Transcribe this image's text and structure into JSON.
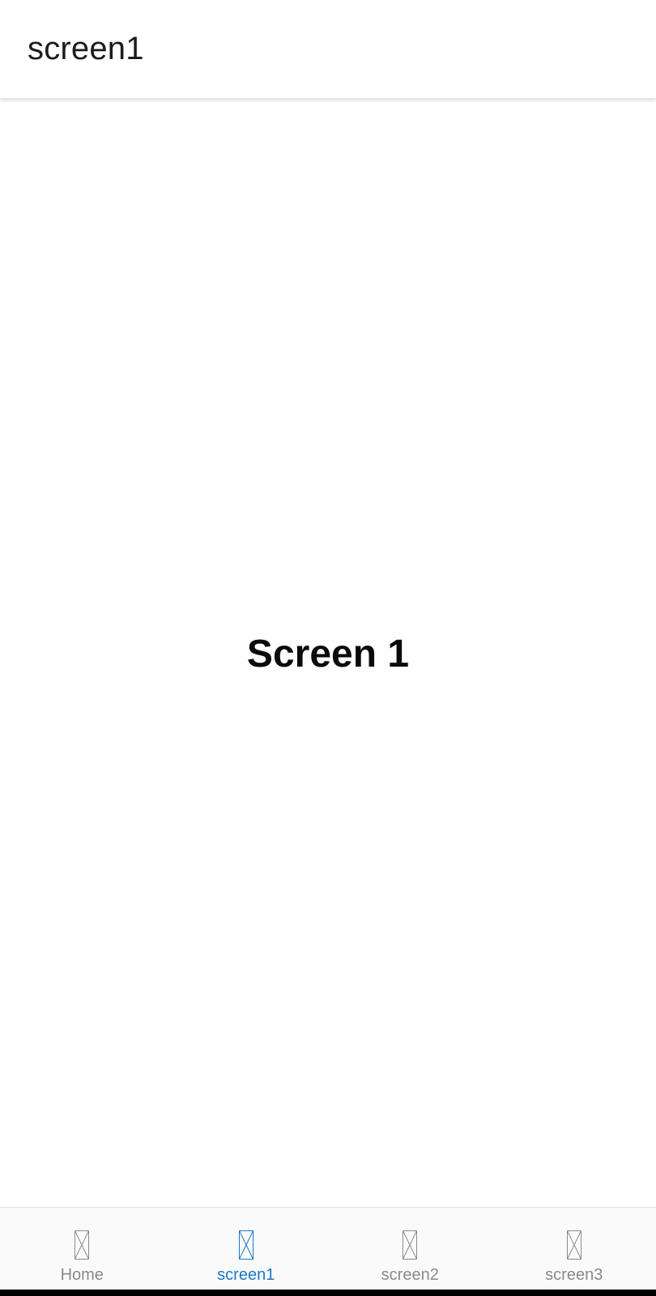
{
  "app_bar": {
    "title": "screen1"
  },
  "main": {
    "heading": "Screen 1"
  },
  "tab_bar": {
    "active_color": "#1a78c8",
    "inactive_color": "#8a8a8a",
    "tabs": [
      {
        "label": "Home",
        "icon": "placeholder-image-icon",
        "active": false
      },
      {
        "label": "screen1",
        "icon": "placeholder-image-icon",
        "active": true
      },
      {
        "label": "screen2",
        "icon": "placeholder-image-icon",
        "active": false
      },
      {
        "label": "screen3",
        "icon": "placeholder-image-icon",
        "active": false
      }
    ]
  }
}
